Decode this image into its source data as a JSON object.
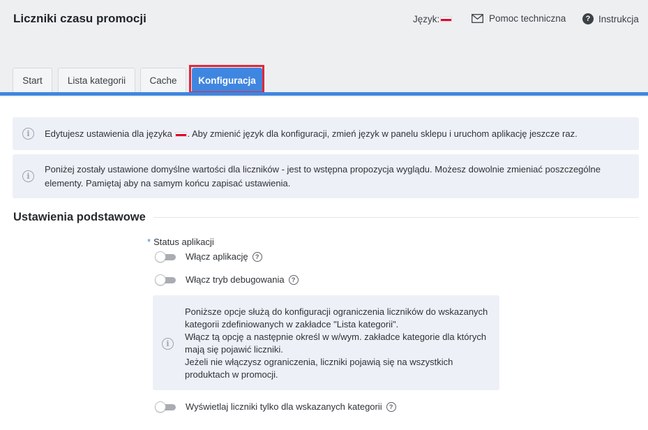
{
  "header": {
    "title": "Liczniki czasu promocji",
    "language_label": "Język:",
    "help_label": "Pomoc techniczna",
    "instructions_label": "Instrukcja"
  },
  "tabs": [
    {
      "label": "Start",
      "active": false
    },
    {
      "label": "Lista kategorii",
      "active": false
    },
    {
      "label": "Cache",
      "active": false
    },
    {
      "label": "Konfiguracja",
      "active": true
    }
  ],
  "alerts": {
    "language_before": "Edytujesz ustawienia dla języka",
    "language_after": ". Aby zmienić język dla konfiguracji, zmień język w panelu sklepu i uruchom aplikację jeszcze raz.",
    "defaults_line1": "Poniżej zostały ustawione domyślne wartości dla liczników - jest to wstępna propozycja wyglądu. Możesz dowolnie zmieniać poszczególne",
    "defaults_line2": "elementy. Pamiętaj aby na samym końcu zapisać ustawienia."
  },
  "section": {
    "title": "Ustawienia podstawowe",
    "status_label": "Status aplikacji",
    "required_mark": "*",
    "toggles": [
      {
        "label": "Włącz aplikację",
        "checked": false
      },
      {
        "label": "Włącz tryb debugowania",
        "checked": false
      }
    ],
    "category_info": [
      "Poniższe opcje służą do konfiguracji ograniczenia liczników do wskazanych",
      "kategorii zdefiniowanych w zakładce \"Lista kategorii\".",
      "Włącz tą opcję a następnie określ w w/wym. zakładce kategorie dla których",
      "mają się pojawić liczniki.",
      "Jeżeli nie włączysz ograniczenia, liczniki pojawią się na wszystkich",
      "produktach w promocji."
    ],
    "category_toggle": {
      "label": "Wyświetlaj liczniki tylko dla wskazanych kategorii",
      "checked": false
    }
  },
  "colors": {
    "accent": "#3f86e0",
    "highlight_border": "#e0283a",
    "header_bg": "#eeeff1",
    "info_bg": "#eef0f7"
  },
  "icons": {
    "help": "envelope-icon",
    "instructions": "question-circle-icon",
    "info": "info-circle-icon",
    "tooltip": "question-circle-icon",
    "language": "flag-pl-icon"
  }
}
